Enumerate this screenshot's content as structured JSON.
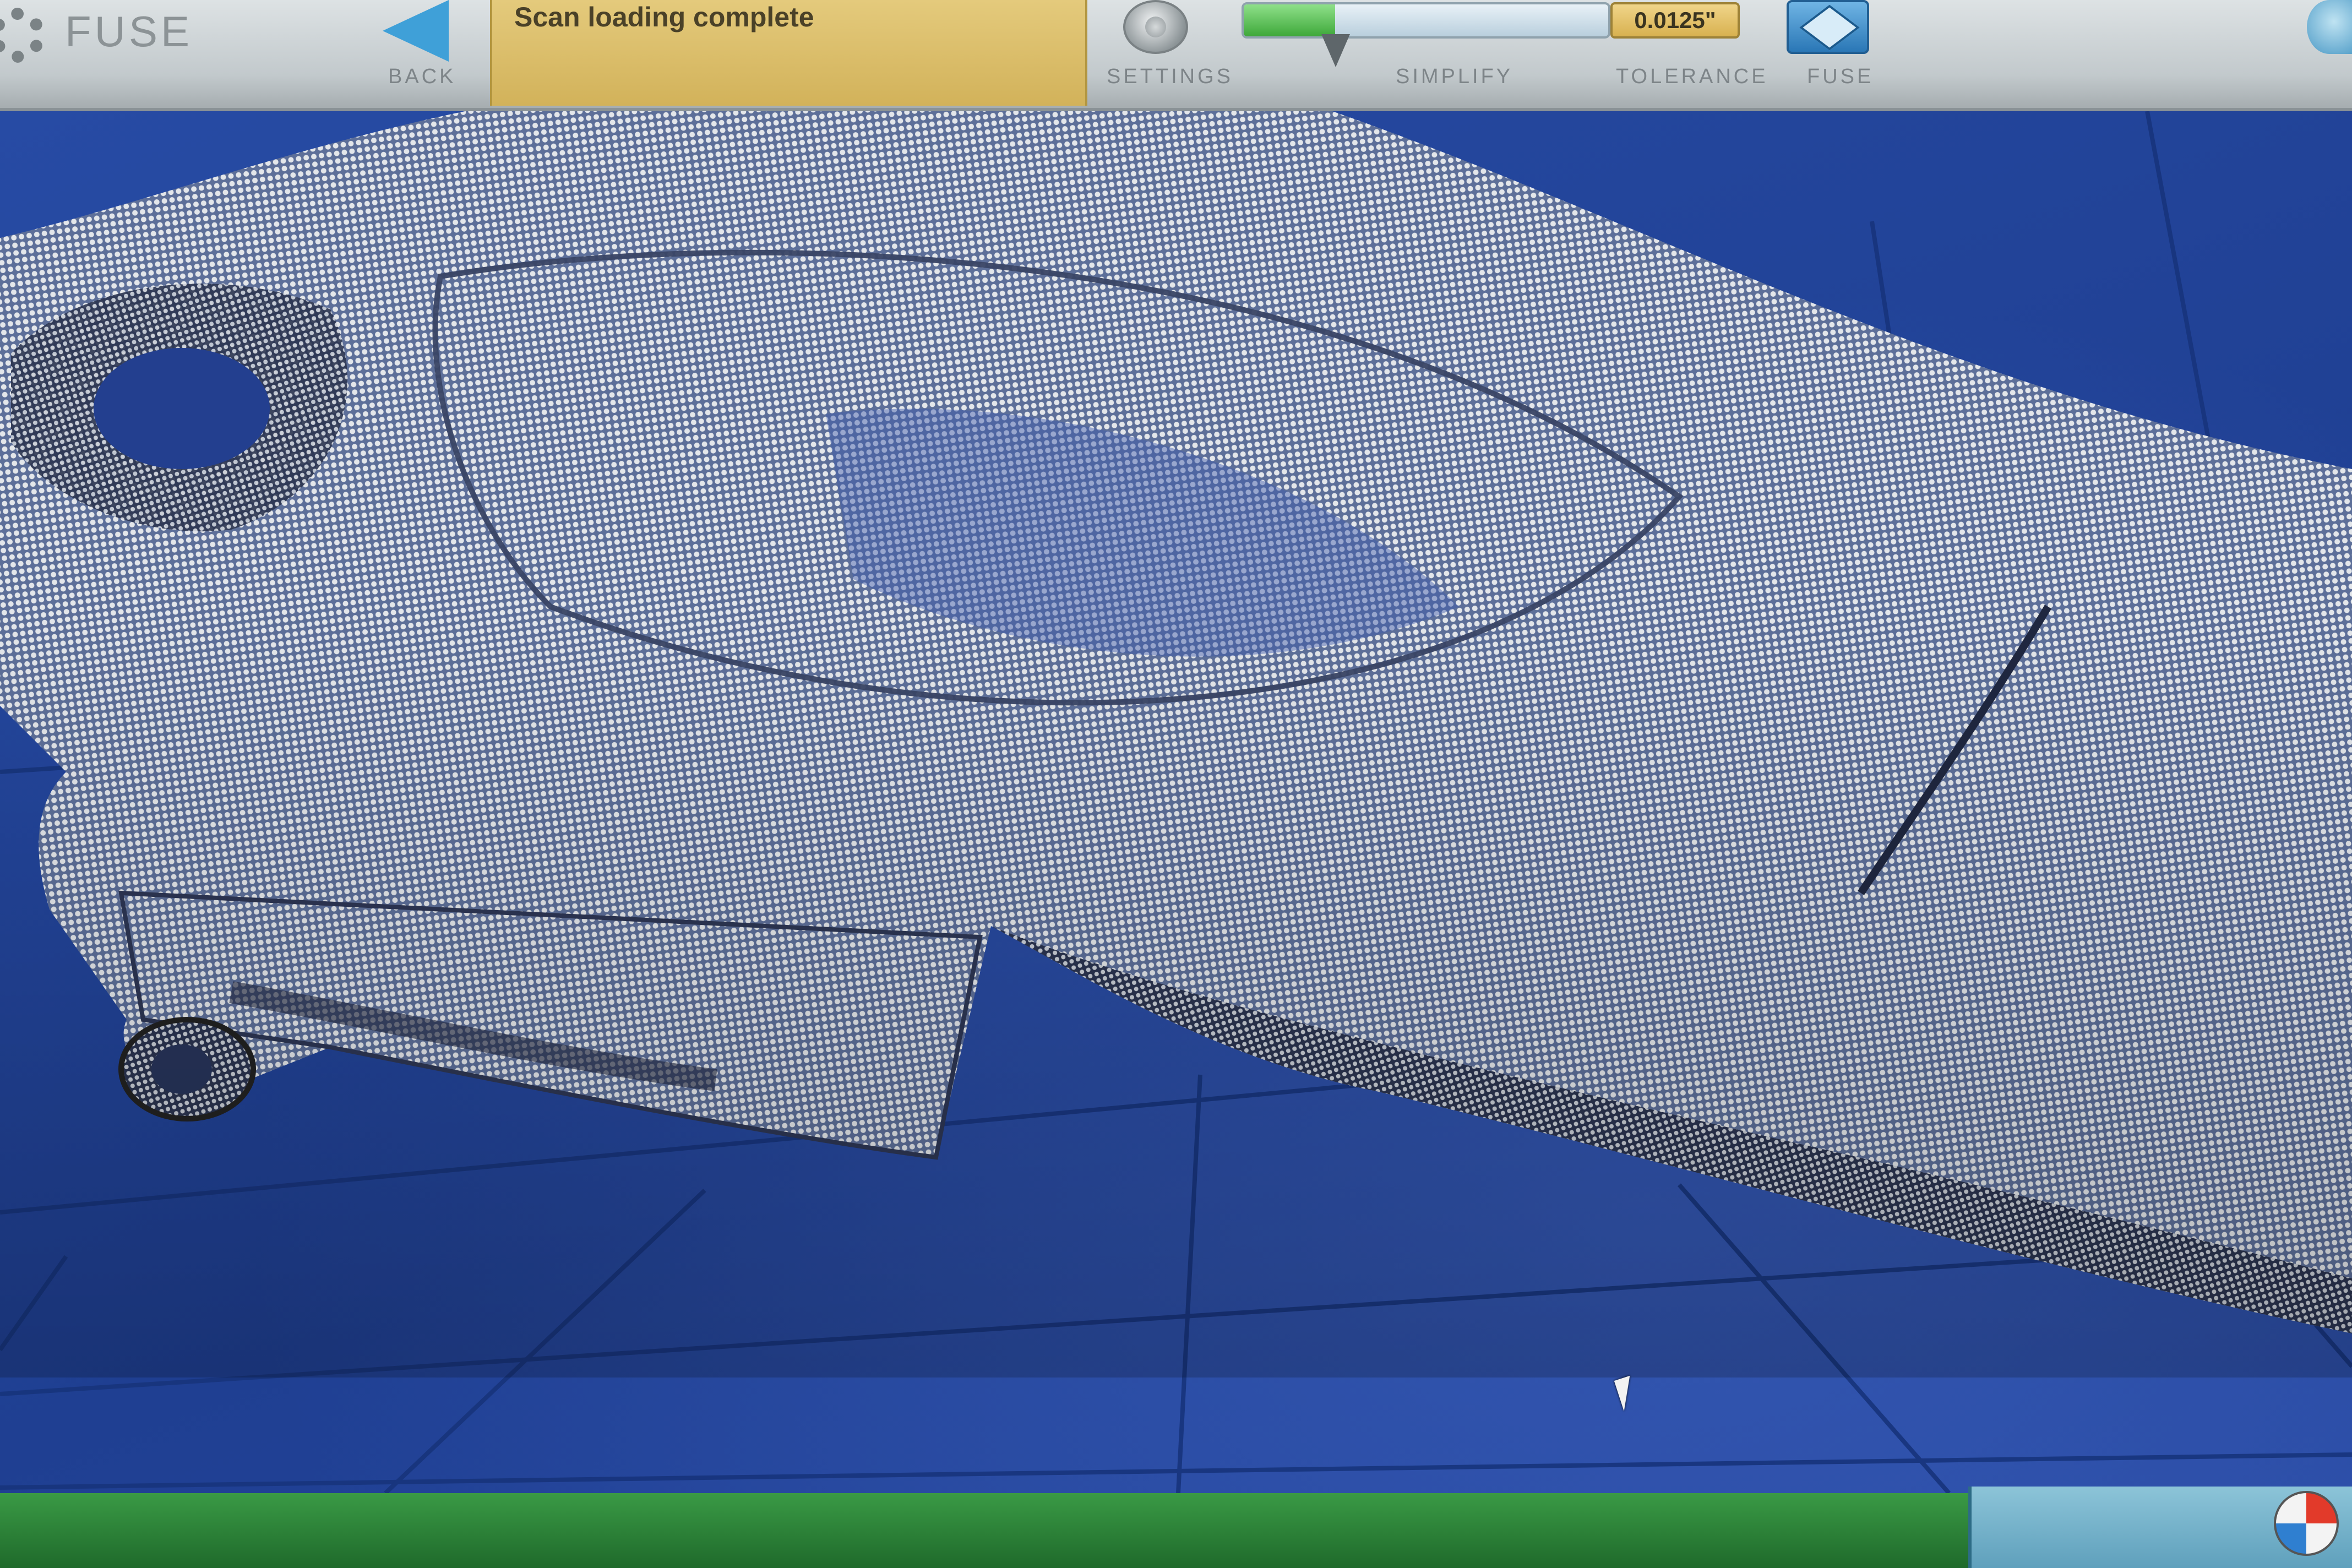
{
  "toolbar": {
    "app_title": "Fuse",
    "back_label": "Back",
    "status_message": "Scan loading complete",
    "settings_label": "Settings",
    "simplify_label": "Simplify",
    "simplify_level_percent": 25,
    "tolerance_label": "Tolerance",
    "tolerance_value": "0.0125\"",
    "fuse_label": "Fuse"
  },
  "icons": {
    "app": "gear-icon",
    "back": "back-arrow-icon",
    "settings": "settings-knob-icon",
    "fuse": "fuse-cube-icon",
    "cursor": "mouse-pointer-icon",
    "orientation": "orientation-ball-icon"
  },
  "colors": {
    "viewport_background": "#274ba4",
    "point_cloud": "#d9dde2",
    "status_bar": "#d9bb66",
    "slider_fill": "#4cb647",
    "bottom_bar": "#2e8a3a"
  }
}
